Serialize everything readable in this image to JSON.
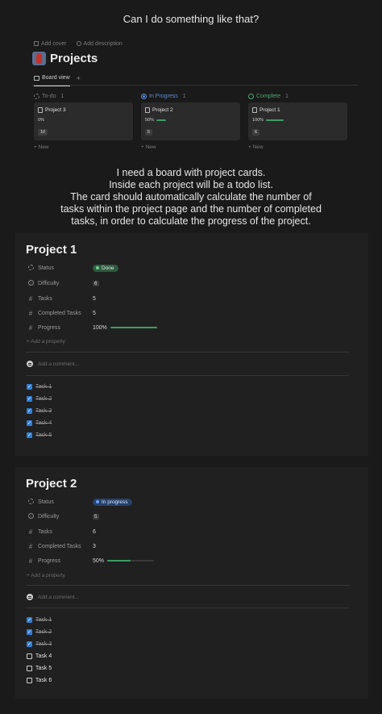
{
  "captions": {
    "top": "Can I do something like that?",
    "middle": [
      "I need a board with project cards.",
      "Inside each project will be a todo list.",
      "The card should automatically calculate the number of",
      "tasks within the project page and the number of completed",
      "tasks, in order to calculate the progress of the project."
    ]
  },
  "board": {
    "add_cover": "Add cover",
    "add_description": "Add description",
    "title": "Projects",
    "view_tab": "Board view",
    "add_view": "+",
    "columns": [
      {
        "status": "To-do",
        "count": "1",
        "card_title": "Project 3",
        "progress": "0%",
        "progress_fraction": 0,
        "tasks": "10",
        "new_label": "+ New"
      },
      {
        "status": "In Progress",
        "count": "1",
        "card_title": "Project 2",
        "progress": "50%",
        "progress_fraction": 0.5,
        "tasks": "5",
        "new_label": "+ New"
      },
      {
        "status": "Complete",
        "count": "1",
        "card_title": "Project 1",
        "progress": "100%",
        "progress_fraction": 1,
        "tasks": "6",
        "new_label": "+ New"
      }
    ]
  },
  "project1": {
    "title": "Project 1",
    "labels": {
      "status": "Status",
      "difficulty": "Difficulty",
      "tasks": "Tasks",
      "completed": "Completed Tasks",
      "progress": "Progress"
    },
    "status": "Done",
    "difficulty": "6",
    "tasks": "5",
    "completed": "5",
    "progress": "100%",
    "progress_fraction": 1,
    "add_property": "+ Add a property",
    "comment_placeholder": "Add a comment...",
    "todo": [
      {
        "label": "Task 1",
        "done": true
      },
      {
        "label": "Task 2",
        "done": true
      },
      {
        "label": "Task 3",
        "done": true
      },
      {
        "label": "Task 4",
        "done": true
      },
      {
        "label": "Task 5",
        "done": true
      }
    ]
  },
  "project2": {
    "title": "Project 2",
    "labels": {
      "status": "Status",
      "difficulty": "Difficulty",
      "tasks": "Tasks",
      "completed": "Completed Tasks",
      "progress": "Progress"
    },
    "status": "In progress",
    "difficulty": "5",
    "tasks": "6",
    "completed": "3",
    "progress": "50%",
    "progress_fraction": 0.5,
    "add_property": "+ Add a property",
    "comment_placeholder": "Add a comment...",
    "todo": [
      {
        "label": "Task 1",
        "done": true
      },
      {
        "label": "Task 2",
        "done": true
      },
      {
        "label": "Task 3",
        "done": true
      },
      {
        "label": "Task 4",
        "done": false
      },
      {
        "label": "Task 5",
        "done": false
      },
      {
        "label": "Task 6",
        "done": false
      }
    ]
  },
  "colors": {
    "done_green": "#3f9b64",
    "progress_blue": "#5b8bd4",
    "checkbox_blue": "#2f7fd6",
    "background": "#1a1a1a",
    "panel": "#202020"
  }
}
